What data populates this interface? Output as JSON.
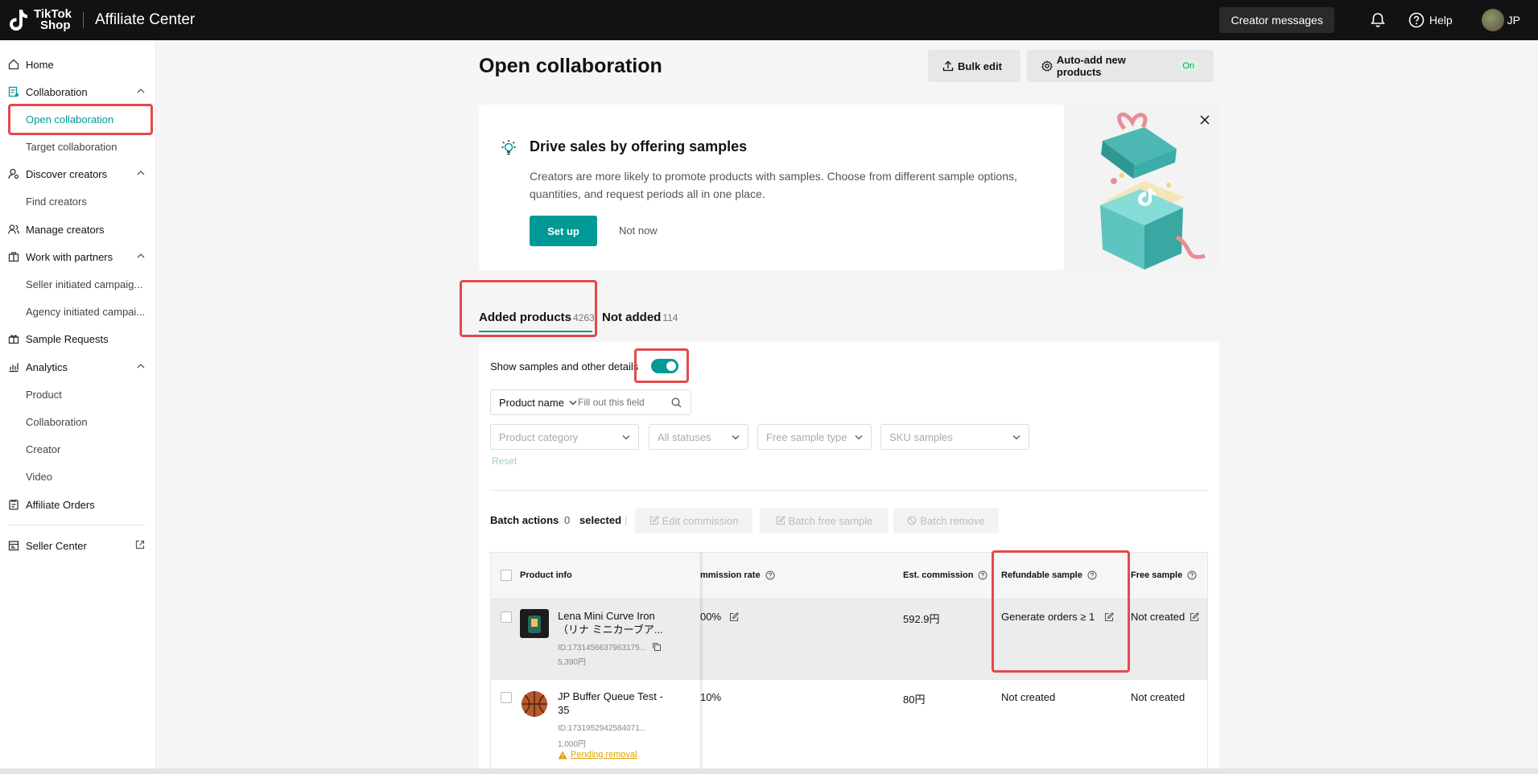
{
  "topbar": {
    "logo_line1": "TikTok",
    "logo_line2": "Shop",
    "title": "Affiliate Center",
    "creator_messages": "Creator messages",
    "help": "Help",
    "user_initials": "JP"
  },
  "sidebar": {
    "home": "Home",
    "collaboration": "Collaboration",
    "open_collaboration": "Open collaboration",
    "target_collaboration": "Target collaboration",
    "discover_creators": "Discover creators",
    "find_creators": "Find creators",
    "manage_creators": "Manage creators",
    "work_with_partners": "Work with partners",
    "seller_initiated": "Seller initiated campaig...",
    "agency_initiated": "Agency initiated campai...",
    "sample_requests": "Sample Requests",
    "analytics": "Analytics",
    "analytics_product": "Product",
    "analytics_collaboration": "Collaboration",
    "analytics_creator": "Creator",
    "analytics_video": "Video",
    "affiliate_orders": "Affiliate Orders",
    "seller_center": "Seller Center"
  },
  "header": {
    "title": "Open collaboration",
    "bulk_edit": "Bulk edit",
    "auto_add": "Auto-add new products",
    "auto_add_status": "On"
  },
  "banner": {
    "title": "Drive sales by offering samples",
    "description": "Creators are more likely to promote products with samples. Choose from different sample options, quantities, and request periods all in one place.",
    "setup": "Set up",
    "not_now": "Not now"
  },
  "tabs": {
    "added_label": "Added products",
    "added_count": "4263",
    "not_added_label": "Not added",
    "not_added_count": "114"
  },
  "filters": {
    "show_samples_label": "Show samples and other details",
    "search_by": "Product name",
    "search_placeholder": "Fill out this field",
    "product_category": "Product category",
    "all_statuses": "All statuses",
    "free_sample_type": "Free sample type",
    "sku_samples": "SKU samples",
    "reset": "Reset"
  },
  "batch": {
    "label": "Batch actions",
    "selected_count": "0",
    "selected_label": "selected",
    "separator": "|",
    "edit_commission": "Edit commission",
    "batch_free_sample": "Batch free sample",
    "batch_remove": "Batch remove"
  },
  "table": {
    "headers": {
      "product_info": "Product info",
      "commission_rate": "mmission rate",
      "est_commission": "Est. commission",
      "refundable_sample": "Refundable sample",
      "free_sample": "Free sample"
    },
    "rows": [
      {
        "name": "Lena Mini Curve Iron （リナ ミニカーブア...",
        "id": "ID:1731456637963175...",
        "price": "5,390円",
        "commission_rate": "00%",
        "est_commission": "592.9円",
        "refundable_sample": "Generate orders ≥ 1",
        "free_sample": "Not created"
      },
      {
        "name": "JP Buffer Queue Test - 35",
        "id": "ID:1731952942584071...",
        "price": "1,000円",
        "status": "Pending removal",
        "commission_rate": "10%",
        "est_commission": "80円",
        "refundable_sample": "Not created",
        "free_sample": "Not created"
      }
    ]
  },
  "colors": {
    "accent": "#009995",
    "highlight": "#e5484d",
    "topbar": "#121212"
  }
}
